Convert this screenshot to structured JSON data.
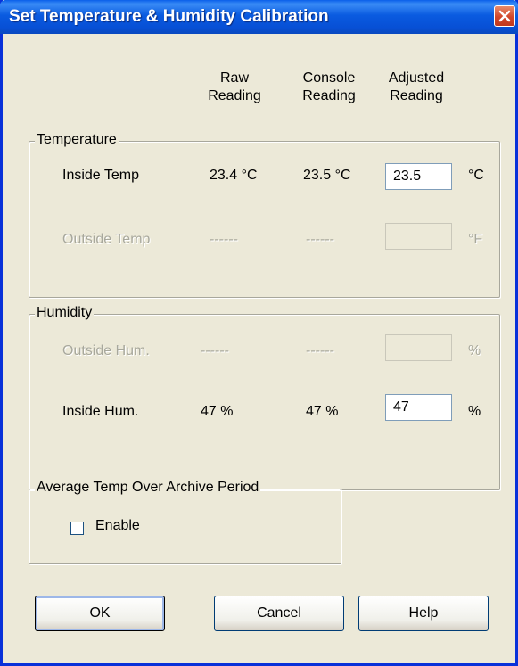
{
  "window": {
    "title": "Set Temperature & Humidity Calibration"
  },
  "columns": {
    "raw": [
      "Raw",
      "Reading"
    ],
    "console": [
      "Console",
      "Reading"
    ],
    "adjusted": [
      "Adjusted",
      "Reading"
    ]
  },
  "temperature": {
    "legend": "Temperature",
    "inside": {
      "label": "Inside Temp",
      "raw": "23.4 °C",
      "console": "23.5 °C",
      "adjusted": "23.5",
      "unit": "°C"
    },
    "outside": {
      "label": "Outside Temp",
      "raw": "------",
      "console": "------",
      "adjusted": "",
      "unit": "°F"
    }
  },
  "humidity": {
    "legend": "Humidity",
    "outside": {
      "label": "Outside Hum.",
      "raw": "------",
      "console": "------",
      "adjusted": "",
      "unit": "%"
    },
    "inside": {
      "label": "Inside Hum.",
      "raw": "47 %",
      "console": "47 %",
      "adjusted": "47",
      "unit": "%"
    }
  },
  "average": {
    "legend": "Average Temp Over Archive Period",
    "enable_label": "Enable",
    "enabled": false
  },
  "buttons": {
    "ok": "OK",
    "cancel": "Cancel",
    "help": "Help"
  },
  "colors": {
    "titlebar": "#0A5BE0",
    "face": "#ECE9D8",
    "disabled_text": "#A8A89C"
  }
}
